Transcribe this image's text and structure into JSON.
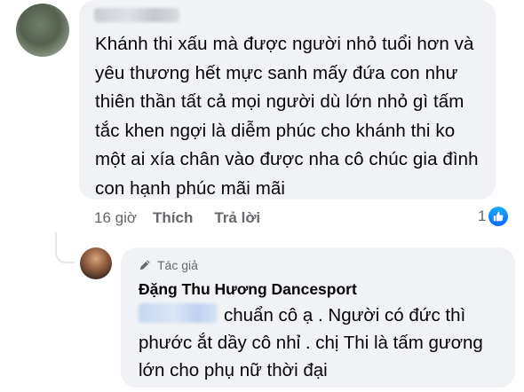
{
  "comment": {
    "text": "Khánh thi xấu mà được người nhỏ tuổi hơn và yêu thương hết mực sanh mấy đứa con như thiên thần tất cả mọi người dù lớn nhỏ gì tấm tắc khen ngợi là diễm phúc cho khánh thi ko một ai xía chân vào được nha cô chúc gia đình con hạnh phúc mãi mãi",
    "time": "16 giờ",
    "like_label": "Thích",
    "reply_label": "Trả lời",
    "reaction_count": "1",
    "reaction_icon": "like-icon",
    "reaction_color": "#0866ff"
  },
  "reply": {
    "badge": "Tác giả",
    "badge_icon": "pen-icon",
    "author": "Đặng Thu Hương Dancesport",
    "text": "chuẩn cô ạ . Người có đức thì phước ắt dầy cô nhỉ . chị Thi là tấm gương lớn cho phụ nữ thời đại"
  }
}
